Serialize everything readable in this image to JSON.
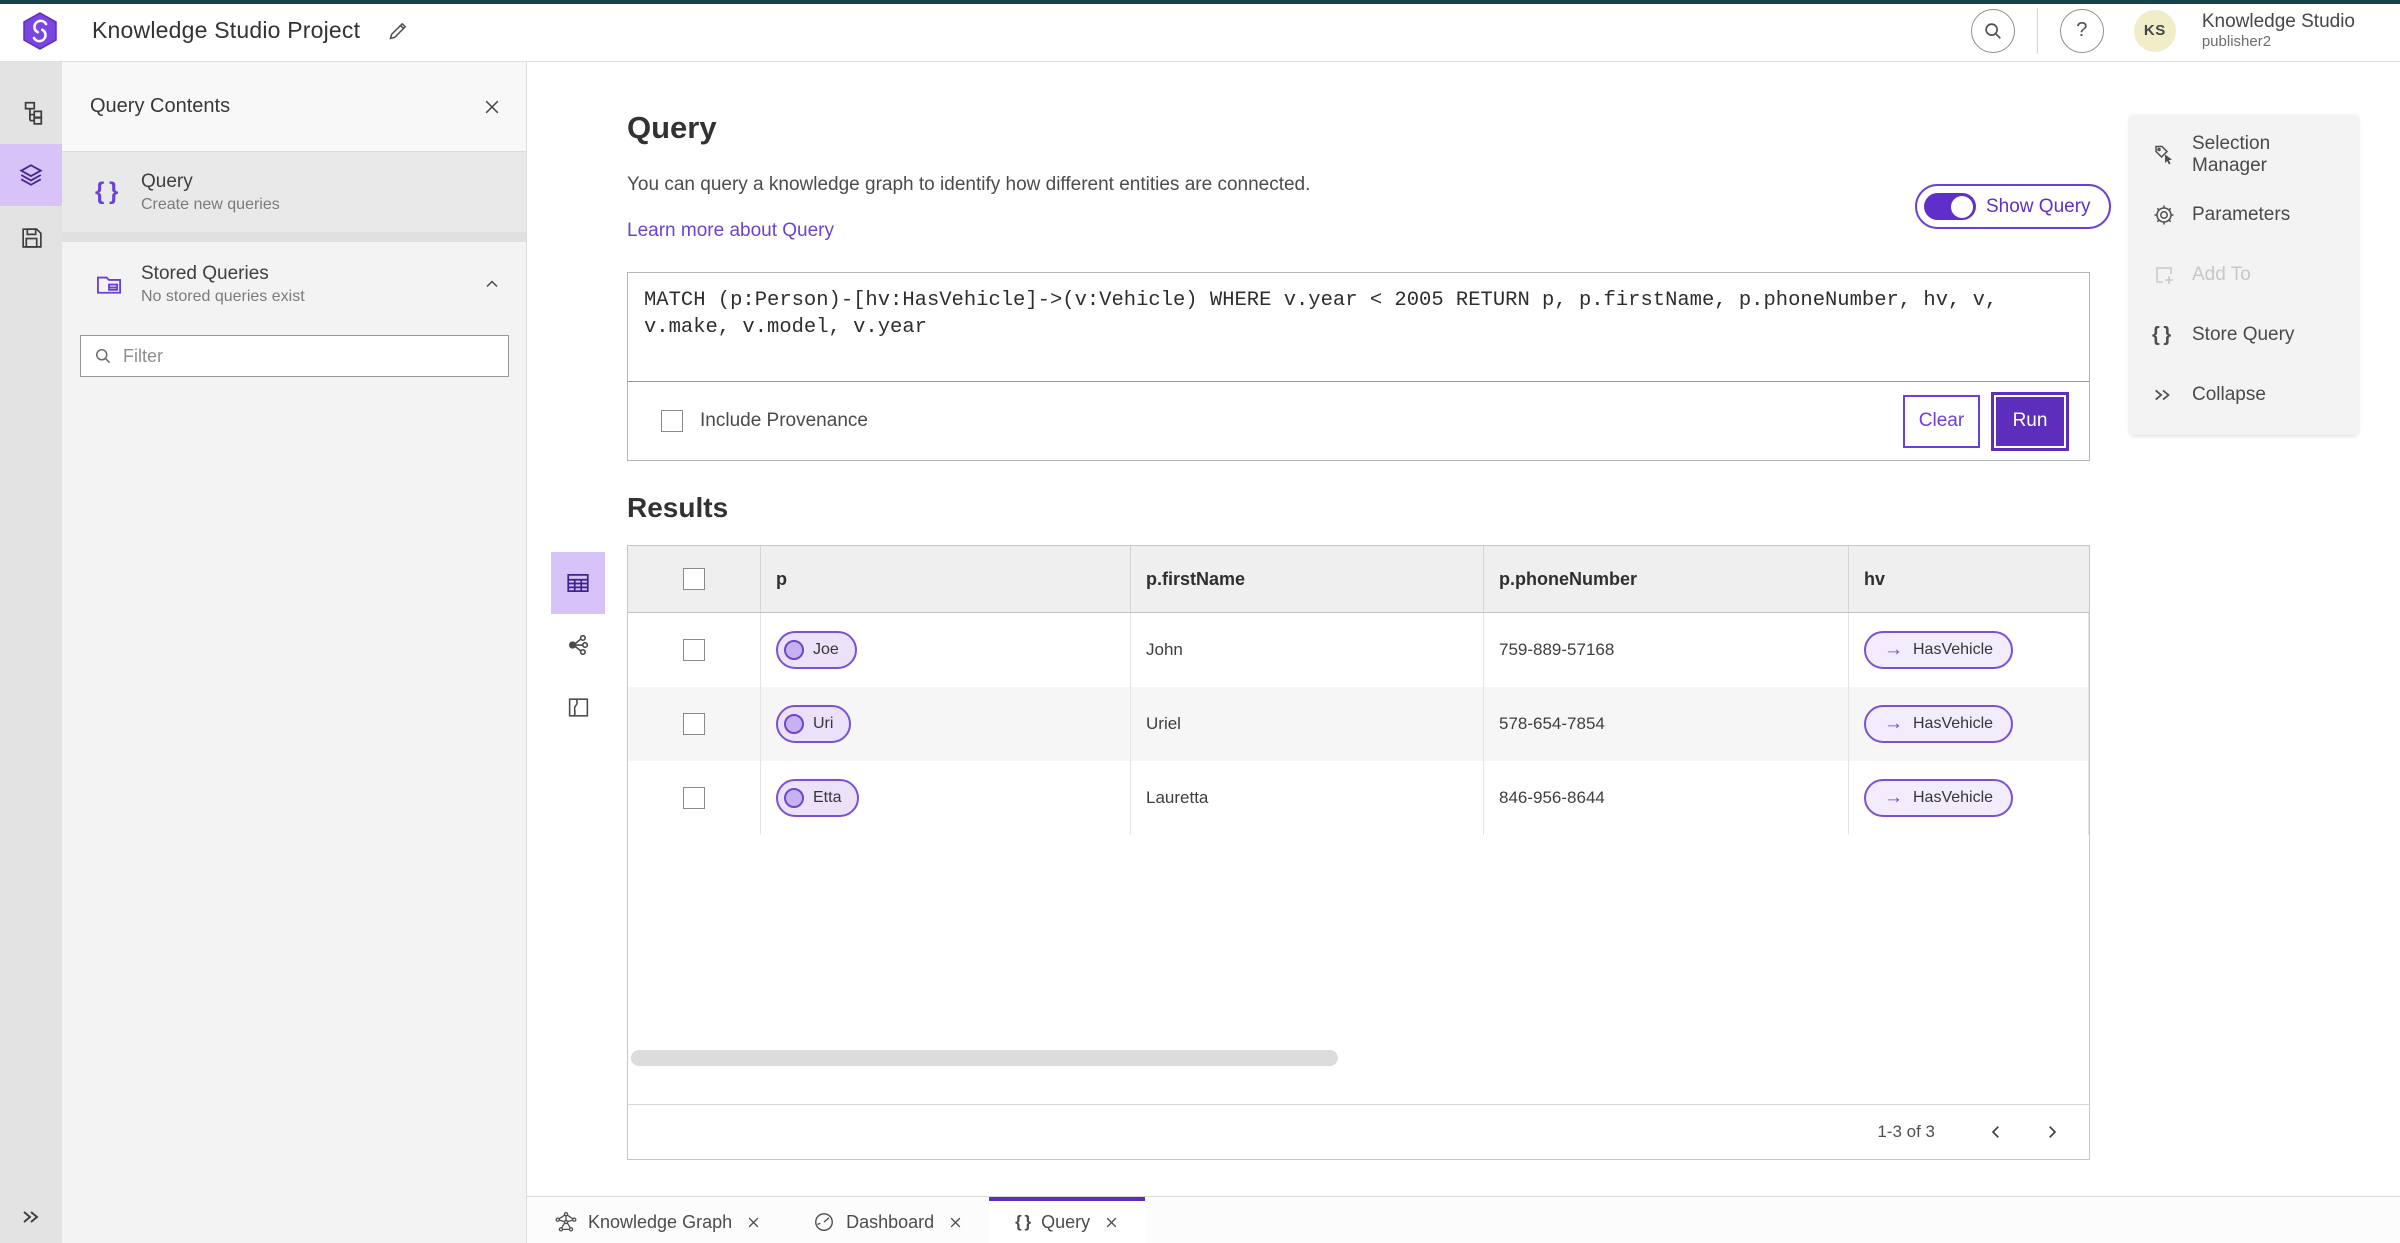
{
  "topbar": {
    "title": "Knowledge Studio Project",
    "account_name": "Knowledge Studio",
    "account_role": "publisher2",
    "avatar_initials": "KS",
    "help_glyph": "?"
  },
  "sidebar": {
    "panel_title": "Query Contents",
    "query_item": {
      "title": "Query",
      "subtitle": "Create new queries"
    },
    "stored_item": {
      "title": "Stored Queries",
      "subtitle": "No stored queries exist"
    },
    "filter_placeholder": "Filter"
  },
  "query_section": {
    "heading": "Query",
    "description": "You can query a knowledge graph to identify how different entities are connected.",
    "learn_more": "Learn more about Query",
    "show_query_label": "Show Query",
    "code": "MATCH (p:Person)-[hv:HasVehicle]->(v:Vehicle) WHERE v.year < 2005 RETURN p, p.firstName, p.phoneNumber, hv, v,\nv.make, v.model, v.year",
    "include_provenance_label": "Include Provenance",
    "clear_label": "Clear",
    "run_label": "Run"
  },
  "results": {
    "heading": "Results",
    "columns": {
      "p": "p",
      "first_name": "p.firstName",
      "phone": "p.phoneNumber",
      "hv": "hv"
    },
    "rows": [
      {
        "entity": "Joe",
        "first_name": "John",
        "phone": "759-889-57168",
        "relationship": "HasVehicle"
      },
      {
        "entity": "Uri",
        "first_name": "Uriel",
        "phone": "578-654-7854",
        "relationship": "HasVehicle"
      },
      {
        "entity": "Etta",
        "first_name": "Lauretta",
        "phone": "846-956-8644",
        "relationship": "HasVehicle"
      }
    ],
    "pagination": "1-3 of 3"
  },
  "tools_panel": {
    "selection_manager": "Selection Manager",
    "parameters": "Parameters",
    "add_to": "Add To",
    "store_query": "Store Query",
    "collapse": "Collapse"
  },
  "tabs": [
    {
      "label": "Knowledge Graph"
    },
    {
      "label": "Dashboard"
    },
    {
      "label": "Query"
    }
  ],
  "glyphs": {
    "braces": "{ }",
    "arrow": "→"
  },
  "colors": {
    "accent": "#6b40d8",
    "deep_purple": "#5d2ebc",
    "teal": "#16444c",
    "lavender": "#d7c3f8"
  }
}
